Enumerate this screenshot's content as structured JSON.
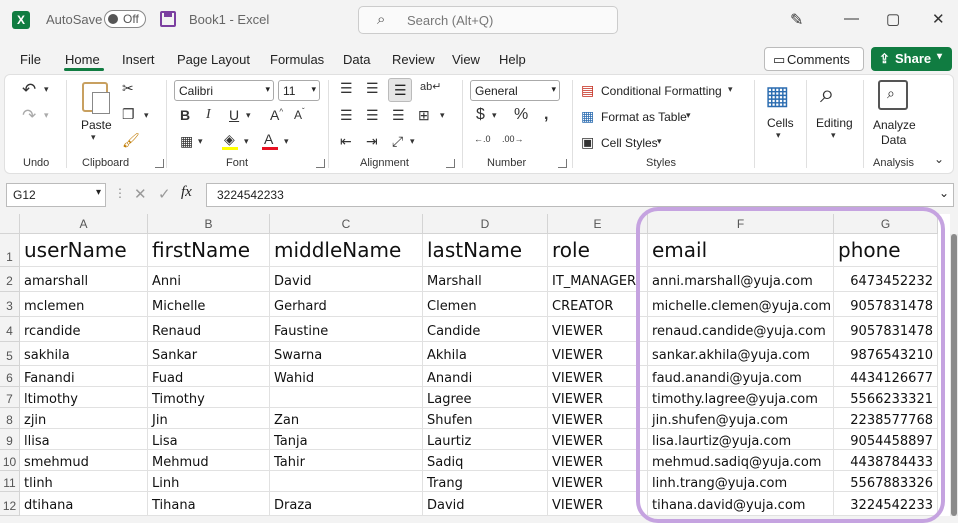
{
  "titlebar": {
    "autosave_label": "AutoSave",
    "autosave_state": "Off",
    "book_title": "Book1  -  Excel",
    "search_placeholder": "Search (Alt+Q)",
    "minimize": "—",
    "restore": "▢",
    "close": "✕"
  },
  "menu": {
    "items": [
      "File",
      "Home",
      "Insert",
      "Page Layout",
      "Formulas",
      "Data",
      "Review",
      "View",
      "Help"
    ],
    "active": "Home",
    "comments_label": "Comments",
    "share_label": "Share"
  },
  "ribbon": {
    "undo_group": "Undo",
    "clipboard": {
      "label": "Clipboard",
      "paste": "Paste"
    },
    "font": {
      "label": "Font",
      "name": "Calibri",
      "size": "11"
    },
    "alignment": {
      "label": "Alignment"
    },
    "number": {
      "label": "Number",
      "format": "General"
    },
    "styles": {
      "label": "Styles",
      "conditional": "Conditional Formatting",
      "format_table": "Format as Table",
      "cell_styles": "Cell Styles"
    },
    "cells": {
      "label": "Cells"
    },
    "editing": {
      "label": "Editing"
    },
    "analysis": {
      "label": "Analysis",
      "analyze": "Analyze",
      "data": "Data"
    },
    "accent_colors": {
      "highlight": "#ffff00",
      "font_color": "#e81123",
      "excel_green": "#107c41"
    }
  },
  "formula_bar": {
    "name_box": "G12",
    "value": "3224542233",
    "fx": "fx"
  },
  "columns": [
    "A",
    "B",
    "C",
    "D",
    "E",
    "F",
    "G"
  ],
  "row_numbers": [
    "1",
    "2",
    "3",
    "4",
    "5",
    "6",
    "7",
    "8",
    "9",
    "10",
    "11",
    "12"
  ],
  "rows": [
    [
      "userName",
      "firstName",
      "middleName",
      "lastName",
      "role",
      "email",
      "phone"
    ],
    [
      "amarshall",
      "Anni",
      "David",
      "Marshall",
      "IT_MANAGER",
      "anni.marshall@yuja.com",
      "6473452232"
    ],
    [
      "mclemen",
      "Michelle",
      "Gerhard",
      "Clemen",
      "CREATOR",
      "michelle.clemen@yuja.com",
      "9057831478"
    ],
    [
      "rcandide",
      "Renaud",
      "Faustine",
      "Candide",
      "VIEWER",
      "renaud.candide@yuja.com",
      "9057831478"
    ],
    [
      "sakhila",
      "Sankar",
      "Swarna",
      "Akhila",
      "VIEWER",
      "sankar.akhila@yuja.com",
      "9876543210"
    ],
    [
      "Fanandi",
      "Fuad",
      "Wahid",
      "Anandi",
      "VIEWER",
      "faud.anandi@yuja.com",
      "4434126677"
    ],
    [
      "ltimothy",
      "Timothy",
      "",
      "Lagree",
      "VIEWER",
      "timothy.lagree@yuja.com",
      "5566233321"
    ],
    [
      "zjin",
      "Jin",
      "Zan",
      "Shufen",
      "VIEWER",
      "jin.shufen@yuja.com",
      "2238577768"
    ],
    [
      "llisa",
      "Lisa",
      "Tanja",
      "Laurtiz",
      "VIEWER",
      "lisa.laurtiz@yuja.com",
      "9054458897"
    ],
    [
      "smehmud",
      "Mehmud",
      "Tahir",
      "Sadiq",
      "VIEWER",
      "mehmud.sadiq@yuja.com",
      "4438784433"
    ],
    [
      "tlinh",
      "Linh",
      "",
      "Trang",
      "VIEWER",
      "linh.trang@yuja.com",
      "5567883326"
    ],
    [
      "dtihana",
      "Tihana",
      "Draza",
      "David",
      "VIEWER",
      "tihana.david@yuja.com",
      "3224542233"
    ]
  ]
}
